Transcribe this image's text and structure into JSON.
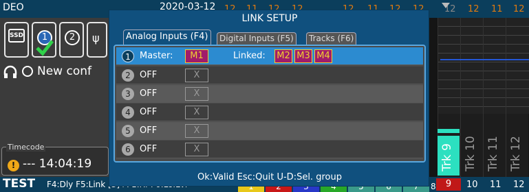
{
  "topbar": {
    "device_name": "DEO",
    "date_peek": "2020-03-12",
    "track_numbers": [
      "12",
      "11",
      "12",
      "12",
      "12",
      "11",
      "12",
      "12",
      "12",
      "12",
      "11",
      "12"
    ]
  },
  "left_panel": {
    "media": [
      {
        "name": "ssd",
        "label": "SSD"
      },
      {
        "name": "card-1",
        "label": "1",
        "selected": true
      },
      {
        "name": "card-2",
        "label": "2"
      },
      {
        "name": "usb",
        "label": "ψ"
      }
    ],
    "conf_text": "New conf",
    "timecode_label": "Timecode",
    "timecode_value": "--- 14:04:19",
    "warn_symbol": "!"
  },
  "dialog": {
    "title": "LINK SETUP",
    "tabs": [
      "Analog Inputs (F4)",
      "Digital Inputs (F5)",
      "Tracks (F6)"
    ],
    "active_tab": 0,
    "rows": [
      {
        "num": "1",
        "mode": "Master:",
        "master": "M1",
        "linked_label": "Linked:",
        "linked": [
          "M2",
          "M3",
          "M4"
        ]
      },
      {
        "num": "2",
        "mode": "OFF",
        "box": "X"
      },
      {
        "num": "3",
        "mode": "OFF",
        "box": "X"
      },
      {
        "num": "4",
        "mode": "OFF",
        "box": "X"
      },
      {
        "num": "5",
        "mode": "OFF",
        "box": "X"
      },
      {
        "num": "6",
        "mode": "OFF",
        "box": "X"
      }
    ],
    "footer": "Ok:Valid  Esc:Quit  U-D:Sel. group"
  },
  "bottombar": {
    "test_name": "TEST",
    "keys": "F4:Dly  F5:Link  [3]+F1:Rf  F6:Lo.Lvl",
    "track_chips": [
      {
        "label": "1",
        "color": "#e8c81a"
      },
      {
        "label": "2",
        "color": "#c81818"
      },
      {
        "label": "3",
        "color": "#2838c8"
      },
      {
        "label": "4",
        "color": "#28a828"
      },
      {
        "label": "5",
        "color": "#3a9a8a"
      },
      {
        "label": "6",
        "color": "#3a9a8a"
      },
      {
        "label": "7",
        "color": "#3a9a8a"
      },
      {
        "label": "8",
        "color": "#3a9a8a"
      }
    ],
    "selected_track": "9",
    "track_nums": [
      "10",
      "11",
      "12"
    ]
  },
  "meters": {
    "track_labels": [
      "Trk 9",
      "Trk 10",
      "Trk 11",
      "Trk 12"
    ]
  },
  "colors": {
    "accent": "#2c8bd0",
    "dialog_bg": "#10507e",
    "chip_bg": "#a01c6a",
    "chip_text": "#f0d030",
    "meter_green": "#2ce0c0",
    "warning": "#f0a818"
  }
}
